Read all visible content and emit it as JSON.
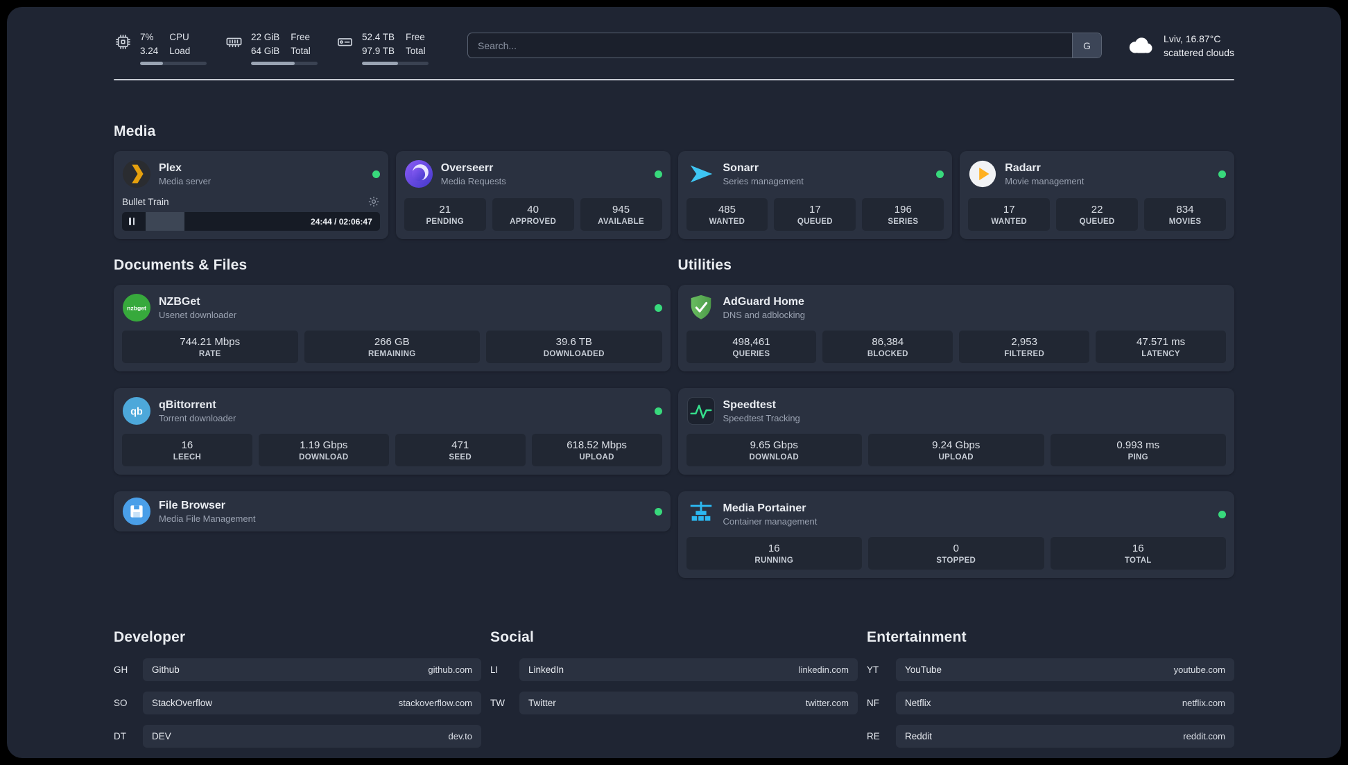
{
  "topbar": {
    "cpu": {
      "value_top": "7%",
      "value_bottom": "3.24",
      "label_top": "CPU",
      "label_bottom": "Load",
      "bar_percent": 34
    },
    "memory": {
      "value_top": "22 GiB",
      "value_bottom": "64 GiB",
      "label_top": "Free",
      "label_bottom": "Total",
      "bar_percent": 66
    },
    "disk": {
      "value_top": "52.4 TB",
      "value_bottom": "97.9 TB",
      "label_top": "Free",
      "label_bottom": "Total",
      "bar_percent": 54
    },
    "search": {
      "placeholder": "Search...",
      "shortcut": "G"
    },
    "weather": {
      "location": "Lviv, 16.87°C",
      "condition": "scattered clouds"
    }
  },
  "media": {
    "title": "Media",
    "plex": {
      "name": "Plex",
      "desc": "Media server",
      "track": "Bullet Train",
      "time": "24:44 / 02:06:47",
      "progress_percent": 15
    },
    "overseerr": {
      "name": "Overseerr",
      "desc": "Media Requests",
      "stats": [
        {
          "value": "21",
          "label": "PENDING"
        },
        {
          "value": "40",
          "label": "APPROVED"
        },
        {
          "value": "945",
          "label": "AVAILABLE"
        }
      ]
    },
    "sonarr": {
      "name": "Sonarr",
      "desc": "Series management",
      "stats": [
        {
          "value": "485",
          "label": "WANTED"
        },
        {
          "value": "17",
          "label": "QUEUED"
        },
        {
          "value": "196",
          "label": "SERIES"
        }
      ]
    },
    "radarr": {
      "name": "Radarr",
      "desc": "Movie management",
      "stats": [
        {
          "value": "17",
          "label": "WANTED"
        },
        {
          "value": "22",
          "label": "QUEUED"
        },
        {
          "value": "834",
          "label": "MOVIES"
        }
      ]
    }
  },
  "documents": {
    "title": "Documents & Files",
    "nzbget": {
      "name": "NZBGet",
      "desc": "Usenet downloader",
      "stats": [
        {
          "value": "744.21 Mbps",
          "label": "RATE"
        },
        {
          "value": "266 GB",
          "label": "REMAINING"
        },
        {
          "value": "39.6 TB",
          "label": "DOWNLOADED"
        }
      ]
    },
    "qbittorrent": {
      "name": "qBittorrent",
      "desc": "Torrent downloader",
      "stats": [
        {
          "value": "16",
          "label": "LEECH"
        },
        {
          "value": "1.19 Gbps",
          "label": "DOWNLOAD"
        },
        {
          "value": "471",
          "label": "SEED"
        },
        {
          "value": "618.52 Mbps",
          "label": "UPLOAD"
        }
      ]
    },
    "filebrowser": {
      "name": "File Browser",
      "desc": "Media File Management"
    }
  },
  "utilities": {
    "title": "Utilities",
    "adguard": {
      "name": "AdGuard Home",
      "desc": "DNS and adblocking",
      "stats": [
        {
          "value": "498,461",
          "label": "QUERIES"
        },
        {
          "value": "86,384",
          "label": "BLOCKED"
        },
        {
          "value": "2,953",
          "label": "FILTERED"
        },
        {
          "value": "47.571 ms",
          "label": "LATENCY"
        }
      ]
    },
    "speedtest": {
      "name": "Speedtest",
      "desc": "Speedtest Tracking",
      "stats": [
        {
          "value": "9.65 Gbps",
          "label": "DOWNLOAD"
        },
        {
          "value": "9.24 Gbps",
          "label": "UPLOAD"
        },
        {
          "value": "0.993 ms",
          "label": "PING"
        }
      ]
    },
    "portainer": {
      "name": "Media Portainer",
      "desc": "Container management",
      "stats": [
        {
          "value": "16",
          "label": "RUNNING"
        },
        {
          "value": "0",
          "label": "STOPPED"
        },
        {
          "value": "16",
          "label": "TOTAL"
        }
      ]
    }
  },
  "bookmarks": {
    "developer": {
      "title": "Developer",
      "items": [
        {
          "abbr": "GH",
          "name": "Github",
          "url": "github.com"
        },
        {
          "abbr": "SO",
          "name": "StackOverflow",
          "url": "stackoverflow.com"
        },
        {
          "abbr": "DT",
          "name": "DEV",
          "url": "dev.to"
        }
      ]
    },
    "social": {
      "title": "Social",
      "items": [
        {
          "abbr": "LI",
          "name": "LinkedIn",
          "url": "linkedin.com"
        },
        {
          "abbr": "TW",
          "name": "Twitter",
          "url": "twitter.com"
        }
      ]
    },
    "entertainment": {
      "title": "Entertainment",
      "items": [
        {
          "abbr": "YT",
          "name": "YouTube",
          "url": "youtube.com"
        },
        {
          "abbr": "NF",
          "name": "Netflix",
          "url": "netflix.com"
        },
        {
          "abbr": "RE",
          "name": "Reddit",
          "url": "reddit.com"
        }
      ]
    }
  },
  "colors": {
    "background": "#1f2533",
    "card": "#2a3140",
    "status_online": "#38d97c",
    "plex_accent": "#e5a00d",
    "sonarr_accent": "#3ec6f4",
    "radarr_accent": "#ffb020",
    "adguard_accent": "#5bae55",
    "speedtest_accent": "#35e08d",
    "portainer_accent": "#2cb9f2"
  },
  "icons": {
    "cpu": "cpu-chip-icon",
    "memory": "ram-icon",
    "disk": "hard-drive-icon",
    "weather": "cloud-icon",
    "plex_settings": "gear-icon",
    "player": "pause-icon",
    "status": "green-dot"
  }
}
